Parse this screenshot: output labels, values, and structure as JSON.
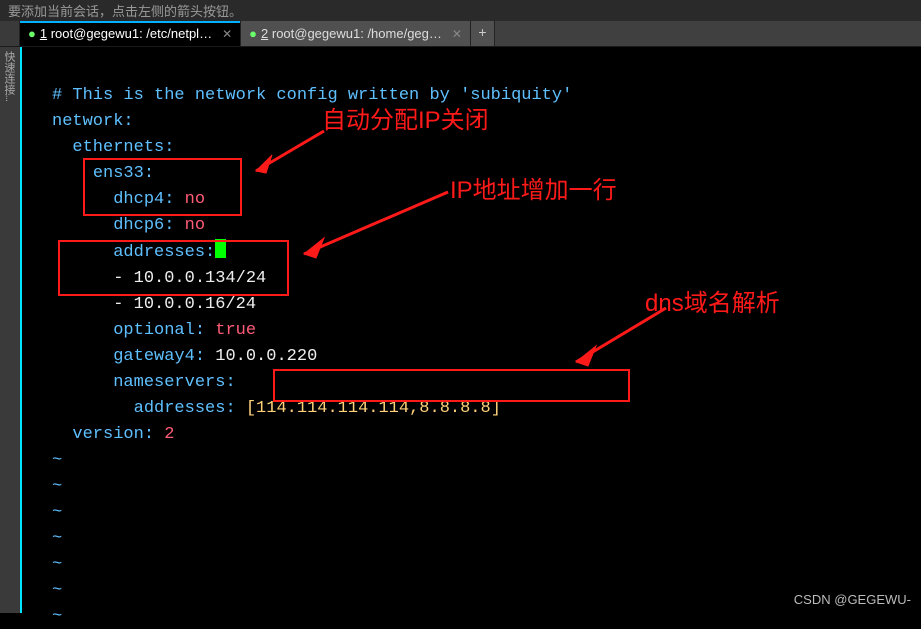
{
  "topbar": {
    "hint": "要添加当前会话，点击左侧的箭头按钮。"
  },
  "tabs": {
    "items": [
      {
        "num": "1",
        "label": "root@gegewu1: /etc/netpl…",
        "active": true
      },
      {
        "num": "2",
        "label": "root@gegewu1: /home/geg…",
        "active": false
      }
    ],
    "add": "+"
  },
  "leftgutter": "快速连接…",
  "code": {
    "comment_line": "# This is the network config written by 'subiquity'",
    "network_key": "network",
    "ethernets_key": "ethernets",
    "ens33_key": "ens33",
    "dhcp4_key": "dhcp4",
    "dhcp4_val": "no",
    "dhcp6_key": "dhcp6",
    "dhcp6_val": "no",
    "addresses_key": "addresses",
    "addr1": "- 10.0.0.134/24",
    "addr2": "- 10.0.0.16/24",
    "optional_key": "optional",
    "optional_val": "true",
    "gateway4_key": "gateway4",
    "gateway4_val": "10.0.0.220",
    "nameservers_key": "nameservers",
    "ns_addresses_key": "addresses",
    "ns_val": "[114.114.114.114,8.8.8.8]",
    "version_key": "version",
    "version_val": "2",
    "tilde": "~"
  },
  "annotations": {
    "a1": "自动分配IP关闭",
    "a2": "IP地址增加一行",
    "a3": "dns域名解析"
  },
  "watermark": "CSDN @GEGEWU-"
}
